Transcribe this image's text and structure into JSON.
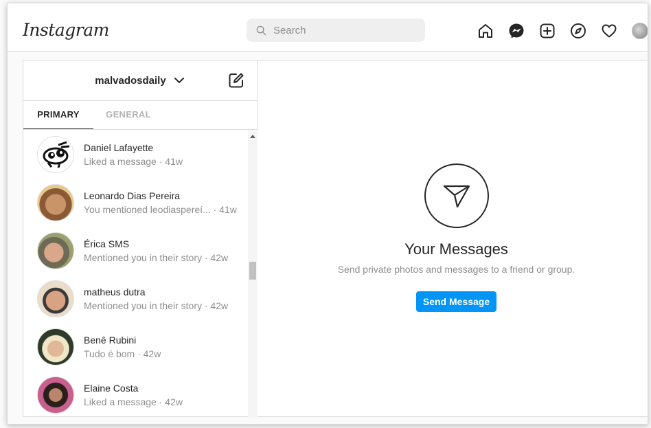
{
  "header": {
    "logo": "Instagram",
    "search_placeholder": "Search",
    "nav_icons": [
      "home-icon",
      "messenger-icon",
      "new-post-icon",
      "explore-icon",
      "activity-heart-icon",
      "profile-avatar"
    ]
  },
  "inbox": {
    "account_name": "malvadosdaily",
    "tabs": [
      {
        "label": "PRIMARY",
        "active": true
      },
      {
        "label": "GENERAL",
        "active": false
      }
    ],
    "threads": [
      {
        "name": "Daniel Lafayette",
        "preview": "Liked a message · 41w"
      },
      {
        "name": "Leonardo Dias Pereira",
        "preview": "You mentioned leodiaspereí...  · 41w"
      },
      {
        "name": "Érica SMS",
        "preview": "Mentioned you in their story · 42w"
      },
      {
        "name": "matheus dutra",
        "preview": "Mentioned you in their story · 42w"
      },
      {
        "name": "Benê Rubini",
        "preview": "Tudo é bom · 42w"
      },
      {
        "name": "Elaine Costa",
        "preview": "Liked a message · 42w"
      }
    ]
  },
  "empty_state": {
    "title": "Your Messages",
    "subtitle": "Send private photos and messages to a friend or group.",
    "button": "Send Message"
  },
  "colors": {
    "accent": "#0095f6",
    "text": "#262626",
    "muted": "#8e8e8e",
    "border": "#dbdbdb"
  }
}
